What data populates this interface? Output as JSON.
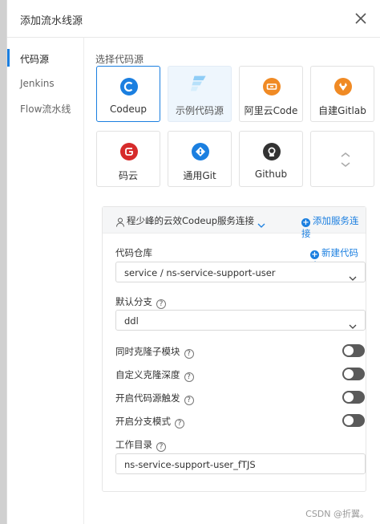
{
  "dialog": {
    "title": "添加流水线源"
  },
  "sidebar": {
    "items": [
      {
        "label": "代码源"
      },
      {
        "label": "Jenkins"
      },
      {
        "label": "Flow流水线"
      }
    ]
  },
  "main": {
    "section_label": "选择代码源",
    "sources": [
      {
        "label": "Codeup",
        "icon": "codeup-icon",
        "color": "#1b7fe0",
        "state": "selected"
      },
      {
        "label": "示例代码源",
        "icon": "sample-source-icon",
        "color": "#5ab0f0",
        "state": "hover"
      },
      {
        "label": "阿里云Code",
        "icon": "aliyun-code-icon",
        "color": "#f08a24"
      },
      {
        "label": "自建Gitlab",
        "icon": "gitlab-icon",
        "color": "#f08a24"
      },
      {
        "label": "码云",
        "icon": "gitee-icon",
        "color": "#d62b2b"
      },
      {
        "label": "通用Git",
        "icon": "git-icon",
        "color": "#1b7fe0"
      },
      {
        "label": "Github",
        "icon": "github-icon",
        "color": "#333333"
      },
      {
        "label": "",
        "icon": "expand-toggle-icon",
        "color": "#999999"
      }
    ],
    "connection": {
      "name": "程少峰的云效Codeup服务连接",
      "add_label": "添加服务连接"
    },
    "repo": {
      "label": "代码仓库",
      "new_label": "新建代码库",
      "value": "service / ns-service-support-user"
    },
    "branch": {
      "label": "默认分支",
      "value": "ddl"
    },
    "toggles": [
      {
        "label": "同时克隆子模块",
        "on": false
      },
      {
        "label": "自定义克隆深度",
        "on": false
      },
      {
        "label": "开启代码源触发",
        "on": false
      },
      {
        "label": "开启分支模式",
        "on": false
      }
    ],
    "workdir": {
      "label": "工作目录",
      "value": "ns-service-support-user_fTJS"
    }
  },
  "watermark": "CSDN @折翼。",
  "colors": {
    "accent": "#1b7fe0",
    "toggle_off": "#5a5a5a"
  }
}
